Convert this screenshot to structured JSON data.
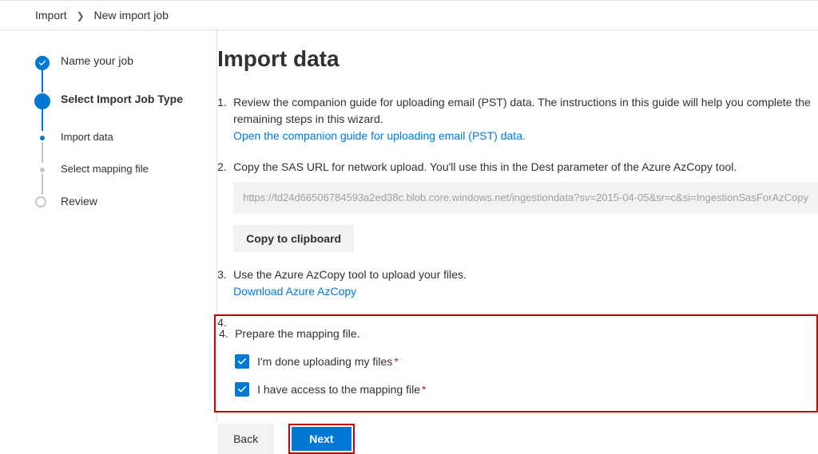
{
  "breadcrumb": {
    "parent": "Import",
    "current": "New import job"
  },
  "steps": [
    {
      "label": "Name your job"
    },
    {
      "label": "Select Import Job Type"
    },
    {
      "label": "Import data"
    },
    {
      "label": "Select mapping file"
    },
    {
      "label": "Review"
    }
  ],
  "page": {
    "title": "Import data",
    "item1": {
      "text": "Review the companion guide for uploading email (PST) data. The instructions in this guide will help you complete the remaining steps in this wizard.",
      "link": "Open the companion guide for uploading email (PST) data."
    },
    "item2": {
      "text": "Copy the SAS URL for network upload. You'll use this in the Dest parameter of the Azure AzCopy tool.",
      "sas": "https://fd24d66506784593a2ed38c.blob.core.windows.net/ingestiondata?sv=2015-04-05&sr=c&si=IngestionSasForAzCopy",
      "copy_btn": "Copy to clipboard"
    },
    "item3": {
      "text": "Use the Azure AzCopy tool to upload your files.",
      "link": "Download Azure AzCopy"
    },
    "item4": {
      "text": "Prepare the mapping file.",
      "cb1": "I'm done uploading my files",
      "cb2": "I have access to the mapping file"
    },
    "buttons": {
      "back": "Back",
      "next": "Next"
    }
  }
}
